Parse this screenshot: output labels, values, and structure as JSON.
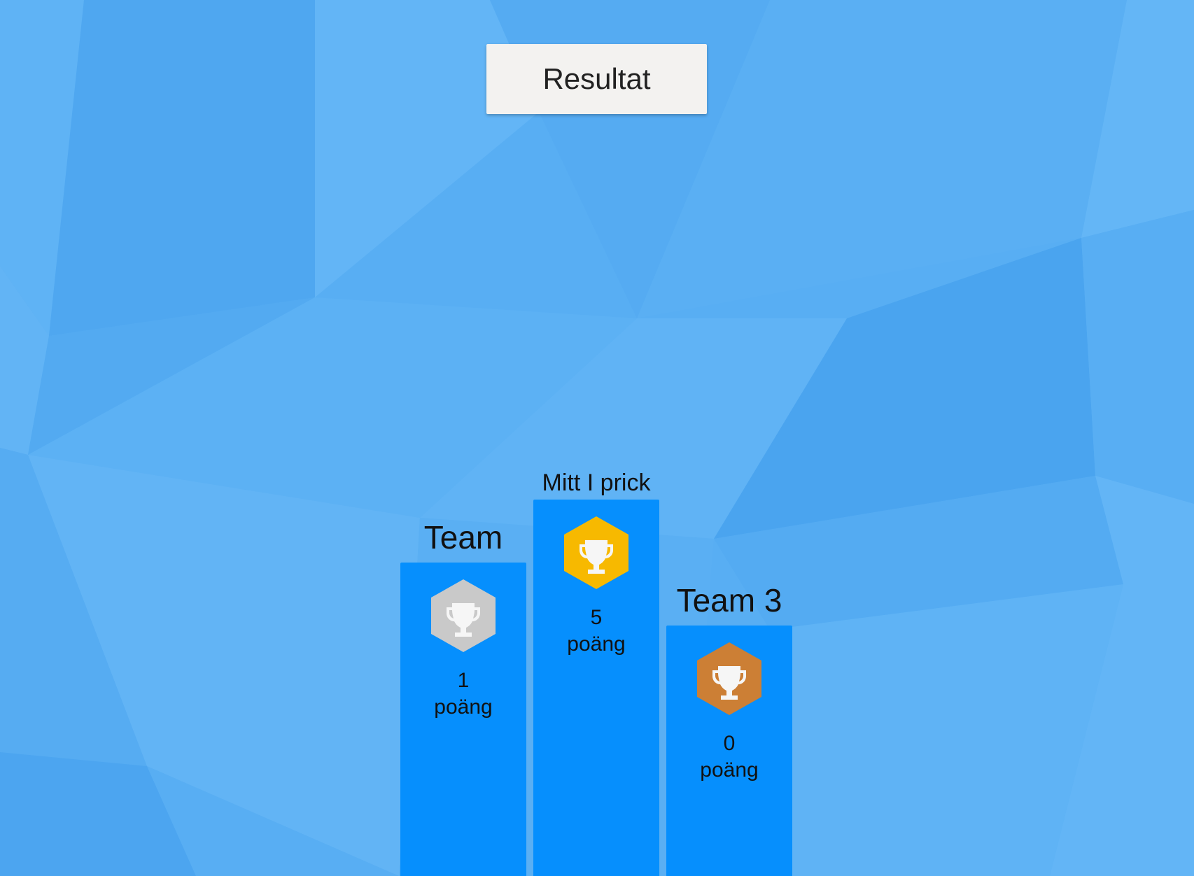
{
  "header": {
    "result_button_label": "Resultat"
  },
  "podium": [
    {
      "place": 2,
      "team": "Team",
      "points": "1",
      "points_unit": "poäng",
      "medal": "silver-trophy-icon",
      "medal_color": "#c9c9c9"
    },
    {
      "place": 1,
      "team": "Mitt I prick",
      "points": "5",
      "points_unit": "poäng",
      "medal": "gold-trophy-icon",
      "medal_color": "#f7b900"
    },
    {
      "place": 3,
      "team": "Team 3",
      "points": "0",
      "points_unit": "poäng",
      "medal": "bronze-trophy-icon",
      "medal_color": "#cc7f35"
    }
  ],
  "colors": {
    "background": "#58aef3",
    "podium_block": "#068ffd",
    "button": "#f3f2f0"
  }
}
